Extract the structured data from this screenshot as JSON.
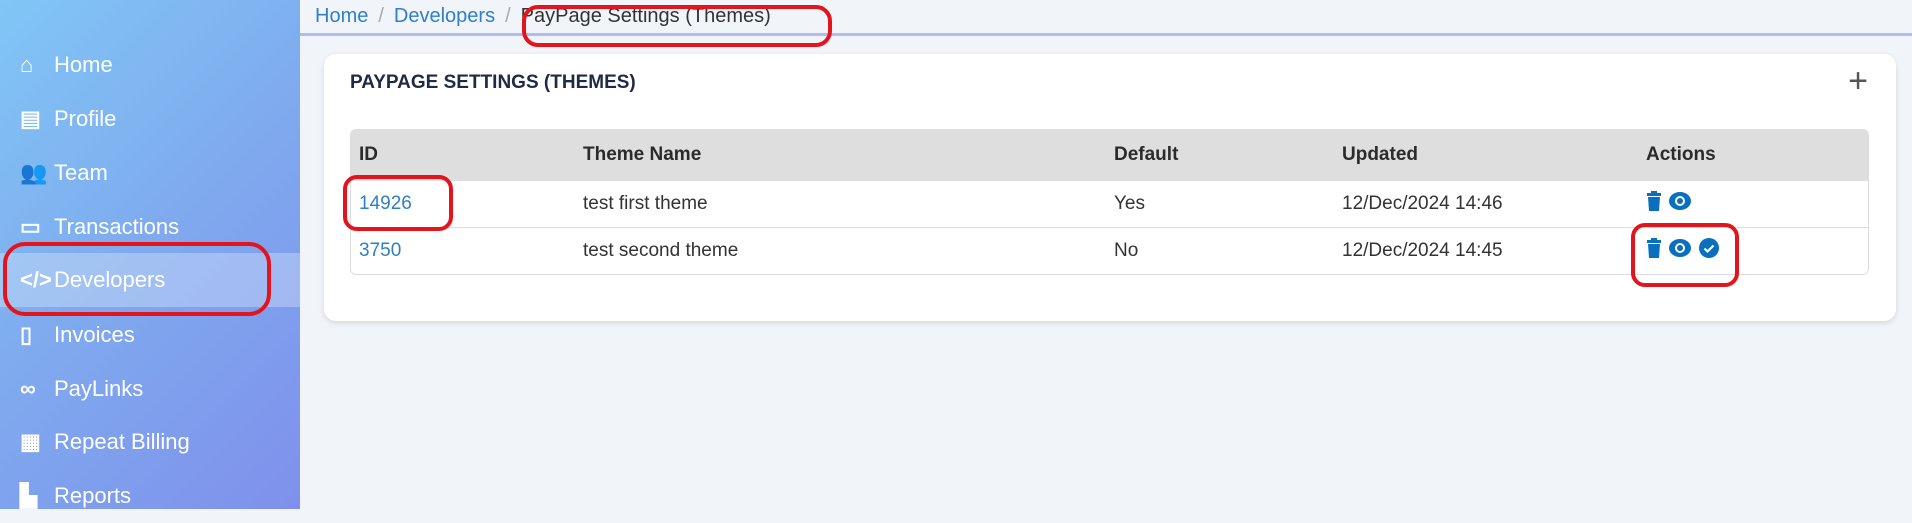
{
  "sidebar": {
    "items": [
      {
        "label": "Home",
        "icon": "home-icon"
      },
      {
        "label": "Profile",
        "icon": "profile-icon"
      },
      {
        "label": "Team",
        "icon": "team-icon"
      },
      {
        "label": "Transactions",
        "icon": "transactions-icon"
      },
      {
        "label": "Developers",
        "icon": "code-icon",
        "active": true
      },
      {
        "label": "Invoices",
        "icon": "invoice-icon"
      },
      {
        "label": "PayLinks",
        "icon": "link-icon"
      },
      {
        "label": "Repeat Billing",
        "icon": "calendar-icon"
      },
      {
        "label": "Reports",
        "icon": "reports-icon"
      }
    ]
  },
  "breadcrumb": {
    "items": [
      "Home",
      "Developers"
    ],
    "current": "PayPage Settings (Themes)",
    "separator": "/"
  },
  "card": {
    "title": "PAYPAGE SETTINGS (THEMES)",
    "add_label": "+"
  },
  "table": {
    "headers": [
      "ID",
      "Theme Name",
      "Default",
      "Updated",
      "Actions"
    ],
    "rows": [
      {
        "id": "14926",
        "name": "test first theme",
        "default": "Yes",
        "updated": "12/Dec/2024 14:46",
        "actions": [
          "delete",
          "view"
        ]
      },
      {
        "id": "3750",
        "name": "test second theme",
        "default": "No",
        "updated": "12/Dec/2024 14:45",
        "actions": [
          "delete",
          "view",
          "set-default"
        ]
      }
    ]
  },
  "colors": {
    "accent": "#2f7fc1",
    "icon": "#0a6fbf",
    "annotation": "#e3141b"
  }
}
